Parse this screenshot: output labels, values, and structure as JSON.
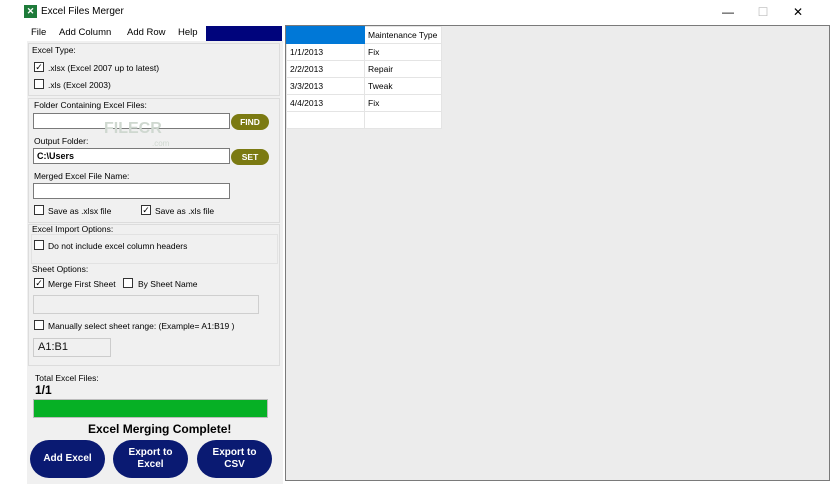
{
  "window": {
    "title": "Excel Files Merger",
    "icon": "excel-icon",
    "minimize": "—",
    "maximize": "☐",
    "close": "✕"
  },
  "menu": [
    "File",
    "Add Column",
    "Add Row",
    "Help"
  ],
  "excel_type": {
    "label": "Excel Type:",
    "xlsx": {
      "label": ".xlsx (Excel 2007 up to latest)",
      "checked": true
    },
    "xls": {
      "label": ".xls (Excel 2003)",
      "checked": false
    }
  },
  "folder": {
    "label": "Folder Containing Excel Files:",
    "value": "",
    "button": "FIND"
  },
  "watermark": {
    "main": "FILECR",
    "sub": ".com"
  },
  "output": {
    "label": "Output Folder:",
    "value": "C:\\Users",
    "button": "SET"
  },
  "merged_name": {
    "label": "Merged Excel File Name:",
    "value": ""
  },
  "save_as": {
    "xlsx": {
      "label": "Save as .xlsx file",
      "checked": false
    },
    "xls": {
      "label": "Save as .xls file",
      "checked": true
    }
  },
  "import_options": {
    "label": "Excel Import Options:",
    "no_headers": {
      "label": "Do not include excel column headers",
      "checked": false
    }
  },
  "sheet_options": {
    "label": "Sheet Options:",
    "merge_first": {
      "label": "Merge First Sheet",
      "checked": true
    },
    "by_name": {
      "label": "By Sheet Name",
      "checked": false
    },
    "sheet_name_value": "",
    "manual_range": {
      "label": "Manually select sheet range: (Example=  A1:B19 )",
      "checked": false
    },
    "range_value": "A1:B1"
  },
  "totals": {
    "label": "Total Excel Files:",
    "count": "1/1",
    "progress": 1.0,
    "status": "Excel Merging Complete!"
  },
  "buttons": {
    "add_excel": "Add Excel",
    "export_excel": "Export to Excel",
    "export_csv": "Export to CSV"
  },
  "grid": {
    "columns": [
      "",
      "Maintenance Type"
    ],
    "rows": [
      [
        "1/1/2013",
        "Fix"
      ],
      [
        "2/2/2013",
        "Repair"
      ],
      [
        "3/3/2013",
        "Tweak"
      ],
      [
        "4/4/2013",
        "Fix"
      ],
      [
        "",
        ""
      ]
    ]
  },
  "colors": {
    "accent_pill": "#7b7a12",
    "big_button": "#0a1a72",
    "progress": "#06b025",
    "menu_fill": "#00047c",
    "grid_header": "#0078d7"
  }
}
